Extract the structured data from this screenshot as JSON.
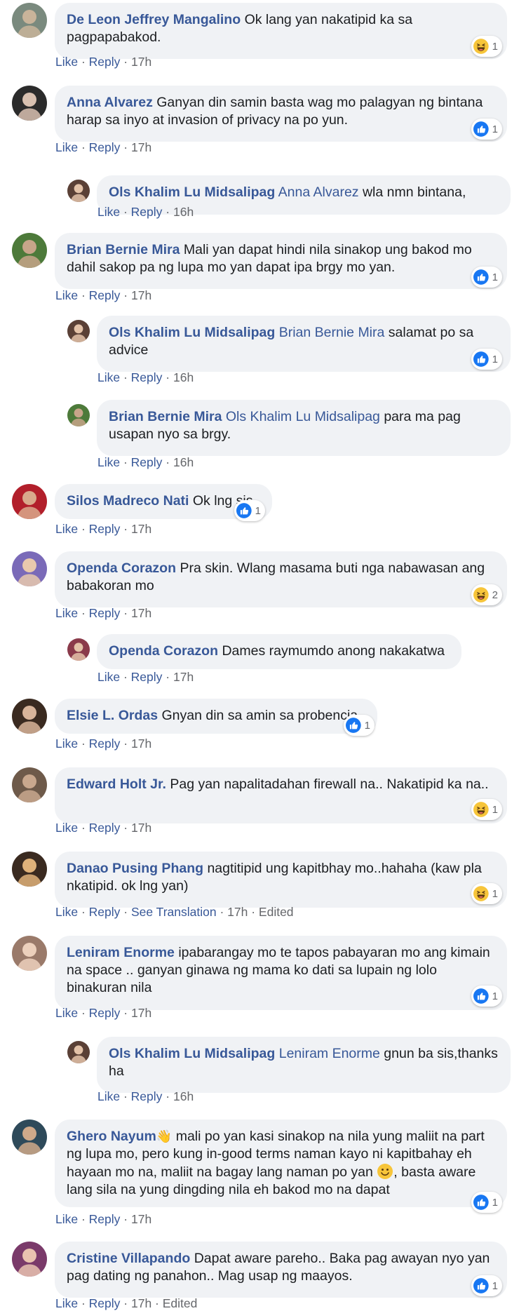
{
  "labels": {
    "like": "Like",
    "reply": "Reply",
    "see_translation": "See Translation",
    "edited": "Edited"
  },
  "colors": {
    "bubble": "#f0f2f5",
    "author": "#385898",
    "meta": "#65676b",
    "like_blue": "#1877f2",
    "haha_yellow": "#f7c53a"
  },
  "comments": [
    {
      "author": "De Leon Jeffrey Mangalino",
      "text": "Ok lang yan nakatipid ka sa pagpapabakod.",
      "time": "17h",
      "reaction": {
        "type": "haha",
        "count": "1"
      },
      "avatar_icon": "person-avatar-icon"
    },
    {
      "author": "Anna Alvarez",
      "text": "Ganyan din samin basta wag mo palagyan ng bintana harap sa inyo at invasion of privacy na po yun.",
      "time": "17h",
      "reaction": {
        "type": "like",
        "count": "1"
      },
      "avatar_icon": "person-avatar-icon"
    },
    {
      "author": "Ols Khalim Lu Midsalipag",
      "mention": "Anna Alvarez",
      "text": "wla nmn bintana,",
      "time": "16h",
      "avatar_icon": "person-avatar-icon"
    },
    {
      "author": "Brian Bernie Mira",
      "text": "Mali yan dapat hindi nila sinakop ung bakod mo dahil sakop pa ng lupa mo yan dapat ipa brgy mo yan.",
      "time": "17h",
      "reaction": {
        "type": "like",
        "count": "1"
      },
      "avatar_icon": "person-avatar-icon"
    },
    {
      "author": "Ols Khalim Lu Midsalipag",
      "mention": "Brian Bernie Mira",
      "text": "salamat po sa advice",
      "time": "16h",
      "reaction": {
        "type": "like",
        "count": "1"
      },
      "avatar_icon": "person-avatar-icon"
    },
    {
      "author": "Brian Bernie Mira",
      "mention": "Ols Khalim Lu Midsalipag",
      "text": "para ma pag usapan nyo sa brgy.",
      "time": "16h",
      "avatar_icon": "person-avatar-icon"
    },
    {
      "author": "Silos Madreco Nati",
      "text": "Ok lng sis",
      "time": "17h",
      "reaction": {
        "type": "like",
        "count": "1"
      },
      "avatar_icon": "person-avatar-icon"
    },
    {
      "author": "Openda Corazon",
      "text": "Pra skin. Wlang masama buti nga nabawasan ang babakoran mo",
      "time": "17h",
      "reaction": {
        "type": "haha",
        "count": "2"
      },
      "avatar_icon": "person-avatar-icon"
    },
    {
      "author": "Openda Corazon",
      "text": "Dames raymumdo anong nakakatwa",
      "time": "17h",
      "avatar_icon": "person-avatar-icon"
    },
    {
      "author": "Elsie L. Ordas",
      "text": "Gnyan din sa amin sa probencia",
      "time": "17h",
      "reaction": {
        "type": "like",
        "count": "1"
      },
      "avatar_icon": "person-avatar-icon"
    },
    {
      "author": "Edward Holt Jr.",
      "text": "Pag yan napalitadahan firewall na.. Nakatipid ka na..",
      "time": "17h",
      "reaction": {
        "type": "haha",
        "count": "1"
      },
      "avatar_icon": "person-avatar-icon"
    },
    {
      "author": "Danao Pusing Phang",
      "text": "nagtitipid ung kapitbhay mo..hahaha (kaw pla nkatipid. ok lng yan)",
      "time": "17h",
      "reaction": {
        "type": "haha",
        "count": "1"
      },
      "translation": true,
      "edited": true,
      "avatar_icon": "person-avatar-icon"
    },
    {
      "author": "Leniram Enorme",
      "text": "ipabarangay mo te tapos pabayaran mo ang kimain na space .. ganyan ginawa ng mama ko dati sa lupain ng lolo binakuran nila",
      "time": "17h",
      "reaction": {
        "type": "like",
        "count": "1"
      },
      "avatar_icon": "person-avatar-icon"
    },
    {
      "author": "Ols Khalim Lu Midsalipag",
      "mention": "Leniram Enorme",
      "text": "gnun ba sis,thanks ha",
      "time": "16h",
      "avatar_icon": "person-avatar-icon"
    },
    {
      "author": "Ghero Nayum",
      "author_icon": "waving-hand-icon",
      "text": "mali po yan kasi sinakop na nila yung maliit na part ng lupa mo, pero kung in-good terms naman kayo ni kapitbahay eh hayaan mo na, maliit na bagay lang naman po yan",
      "text_tail": ", basta aware lang sila na yung dingding nila eh bakod mo na dapat",
      "inline_icon": "smiley-icon",
      "time": "17h",
      "reaction": {
        "type": "like",
        "count": "1"
      },
      "avatar_icon": "person-avatar-icon"
    },
    {
      "author": "Cristine Villapando",
      "text": "Dapat aware pareho.. Baka pag awayan nyo yan pag dating ng panahon.. Mag usap ng maayos.",
      "time": "17h",
      "reaction": {
        "type": "like",
        "count": "1"
      },
      "edited": true,
      "avatar_icon": "person-avatar-icon"
    }
  ]
}
